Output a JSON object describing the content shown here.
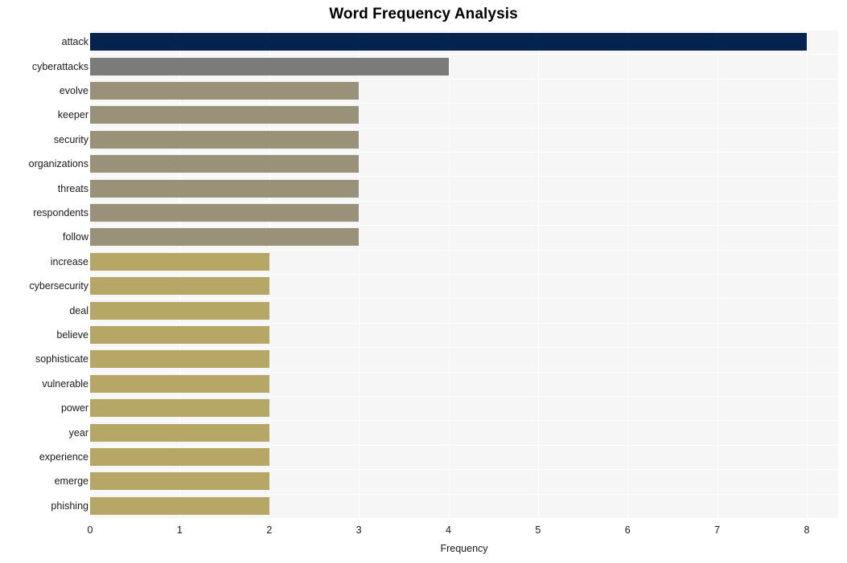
{
  "chart_data": {
    "type": "bar",
    "orientation": "horizontal",
    "title": "Word Frequency Analysis",
    "xlabel": "Frequency",
    "ylabel": "",
    "xlim": [
      0,
      8.35
    ],
    "ylim": [
      0,
      19
    ],
    "grid": true,
    "legend": false,
    "xticks": [
      "0",
      "1",
      "2",
      "3",
      "4",
      "5",
      "6",
      "7",
      "8"
    ],
    "xtick_values": [
      0,
      1,
      2,
      3,
      4,
      5,
      6,
      7,
      8
    ],
    "categories": [
      "attack",
      "cyberattacks",
      "evolve",
      "keeper",
      "security",
      "organizations",
      "threats",
      "respondents",
      "follow",
      "increase",
      "cybersecurity",
      "deal",
      "believe",
      "sophisticate",
      "vulnerable",
      "power",
      "year",
      "experience",
      "emerge",
      "phishing"
    ],
    "values": [
      8,
      4,
      3,
      3,
      3,
      3,
      3,
      3,
      3,
      2,
      2,
      2,
      2,
      2,
      2,
      2,
      2,
      2,
      2,
      2
    ],
    "bar_colors": [
      "#04234f",
      "#7b7b79",
      "#999279",
      "#999279",
      "#999279",
      "#999279",
      "#999279",
      "#999279",
      "#999279",
      "#b6a767",
      "#b6a767",
      "#b6a767",
      "#b6a767",
      "#b6a767",
      "#b6a767",
      "#b6a767",
      "#b6a767",
      "#b6a767",
      "#b6a767",
      "#b6a767"
    ]
  },
  "style": {
    "plot_background": "#f6f6f6",
    "page_background": "#ffffff",
    "gridline_color": "#ffffff",
    "text_color": "#1a1a1a",
    "title_color": "#000000"
  }
}
